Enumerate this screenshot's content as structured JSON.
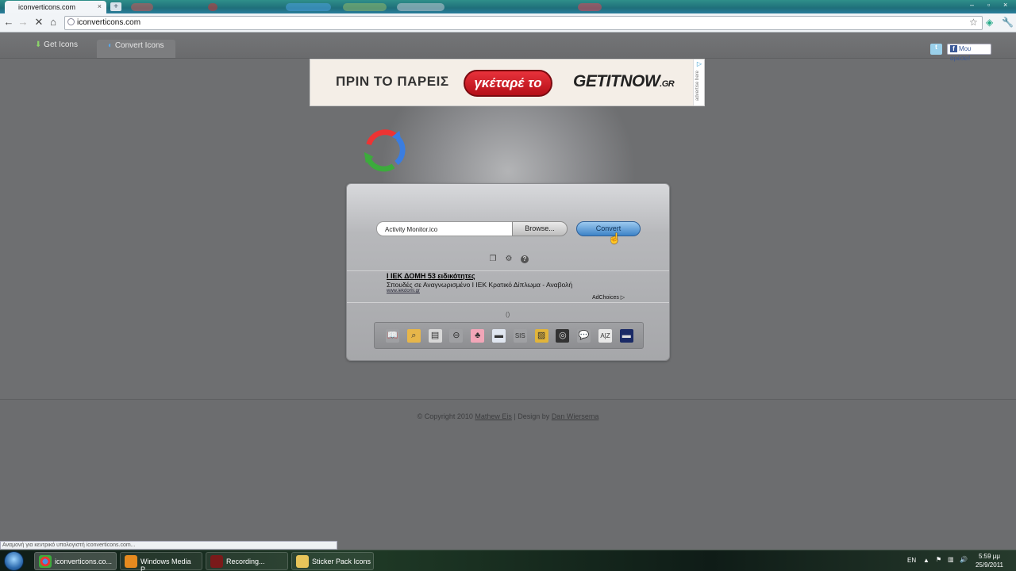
{
  "browser": {
    "tab_title": "iconverticons.com",
    "tab_close": "×",
    "new_tab": "+",
    "url": "iconverticons.com",
    "window_controls": [
      "‒",
      "▫",
      "×"
    ]
  },
  "site": {
    "nav": [
      "Get Icons",
      "Convert Icons"
    ],
    "social": {
      "twitter": "t",
      "facebook_mark": "f",
      "facebook_label": "Μου αρέσει!"
    }
  },
  "ad_banner": {
    "headline": "ΠΡΙΝ ΤΟ ΠΑΡΕΙΣ",
    "pill": "γκέταρέ το",
    "brand": "GETITNOW",
    "brand_suffix": ".GR",
    "side_label": "advertise here"
  },
  "converter": {
    "file_value": "Activity Monitor.ico",
    "browse_label": "Browse...",
    "convert_label": "Convert",
    "help_label": "?"
  },
  "text_ad": {
    "title": "Ι ΙΕΚ ΔΟΜΗ 53 ειδικότητες",
    "description": "Σπουδές σε Αναγνωρισμένο Ι ΙΕΚ Κρατικό Δίπλωμα - Αναβολή",
    "url": "www.iekdomi.gr",
    "adchoices": "AdChoices ▷"
  },
  "icon_strip_caption": "()",
  "icon_strip": [
    {
      "name": "book-icon",
      "glyph": "📖",
      "bg": "#9fa0a3"
    },
    {
      "name": "finder-search-icon",
      "glyph": "⌕",
      "bg": "#e7b64a"
    },
    {
      "name": "notepad-icon",
      "glyph": "▤",
      "bg": "#d7d7d7"
    },
    {
      "name": "stop-icon",
      "glyph": "⊖",
      "bg": "#9fa0a3"
    },
    {
      "name": "cupcake-icon",
      "glyph": "♣",
      "bg": "#f2a6b8"
    },
    {
      "name": "samsung-icon",
      "glyph": "▬",
      "bg": "#e0e6f0"
    },
    {
      "name": "sis-icon",
      "glyph": "SIS",
      "bg": "#9fa0a3"
    },
    {
      "name": "colorful-stripes-icon",
      "glyph": "▨",
      "bg": "#e1b43a"
    },
    {
      "name": "film-reel-icon",
      "glyph": "◎",
      "bg": "#333333"
    },
    {
      "name": "speech-bubble-icon",
      "glyph": "💬",
      "bg": "#9fa0a3"
    },
    {
      "name": "a-z-dictionary-icon",
      "glyph": "A|Z",
      "bg": "#e8e8e8"
    },
    {
      "name": "banner-icon",
      "glyph": "▬",
      "bg": "#1a2a66"
    }
  ],
  "footer": {
    "copyright": "© Copyright 2010",
    "author": "Mathew Eis",
    "separator": "|",
    "design_by": "Design by",
    "designer": "Dan Wiersema"
  },
  "status_bar": "Αναμονή για κεντρικό υπολογιστή iconverticons.com...",
  "taskbar": {
    "tasks": [
      "iconverticons.co...",
      "Windows Media P...",
      "Recording...",
      "Sticker Pack Icons"
    ],
    "lang": "EN",
    "time": "5:59 μμ",
    "date": "25/9/2011"
  }
}
